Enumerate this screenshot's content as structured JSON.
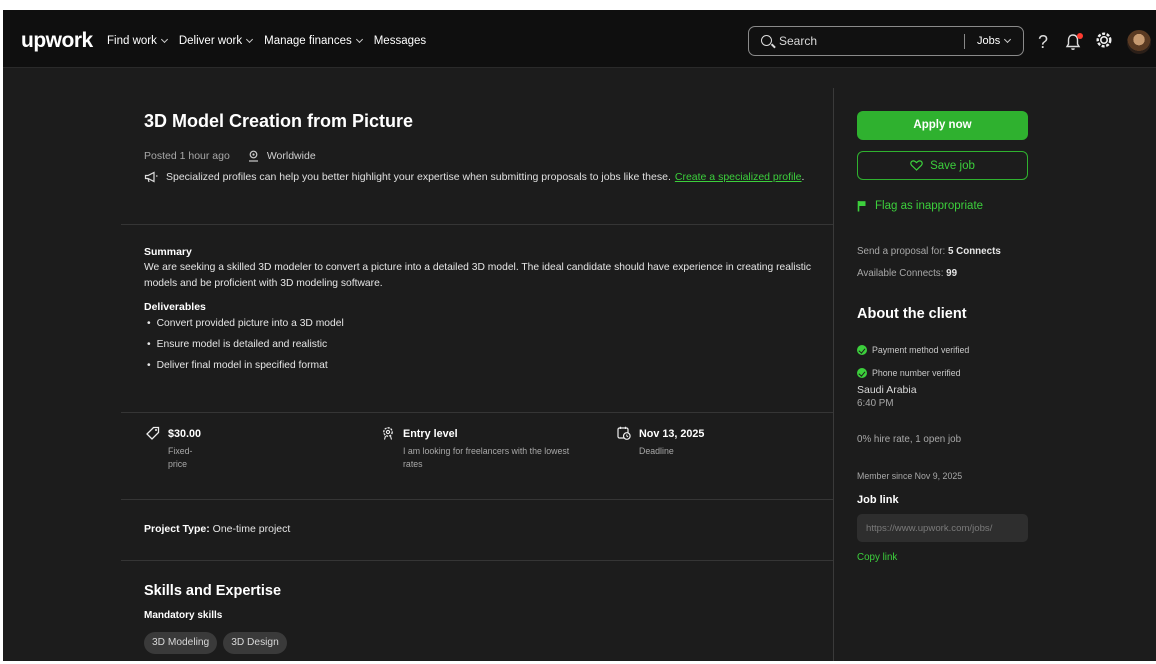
{
  "nav": {
    "logo": "upwork",
    "links": [
      "Find work",
      "Deliver work",
      "Manage finances",
      "Messages"
    ],
    "search_placeholder": "Search",
    "search_scope": "Jobs",
    "help": "?"
  },
  "job": {
    "title": "3D Model Creation from Picture",
    "posted": "Posted 1 hour ago",
    "location": "Worldwide",
    "tip_text": "Specialized profiles can help you better highlight your expertise when submitting proposals to jobs like these.",
    "tip_link": "Create a specialized profile",
    "summary_heading": "Summary",
    "summary_text": "We are seeking a skilled 3D modeler to convert a picture into a detailed 3D model. The ideal candidate should have experience in creating realistic models and be proficient with 3D modeling software.",
    "deliverables_heading": "Deliverables",
    "deliverables": [
      "Convert provided picture into a 3D model",
      "Ensure model is detailed and realistic",
      "Deliver final model in specified format"
    ],
    "facts": {
      "price": "$30.00",
      "price_sub": "Fixed-price",
      "level": "Entry level",
      "level_sub": "I am looking for freelancers with the lowest rates",
      "deadline": "Nov 13, 2025",
      "deadline_sub": "Deadline"
    },
    "project_type_label": "Project Type:",
    "project_type_value": "One-time project",
    "skills_heading": "Skills and Expertise",
    "mandatory_label": "Mandatory skills",
    "skills": [
      "3D Modeling",
      "3D Design"
    ]
  },
  "sidebar": {
    "apply_label": "Apply now",
    "save_label": "Save job",
    "flag_label": "Flag as inappropriate",
    "proposal_label": "Send a proposal for:",
    "proposal_value": "5 Connects",
    "available_label": "Available Connects:",
    "available_value": "99",
    "about_heading": "About the client",
    "payment_verified": "Payment method verified",
    "phone_verified": "Phone number verified",
    "country": "Saudi Arabia",
    "client_time": "6:40 PM",
    "hire_rate": "0% hire rate, 1 open job",
    "member_since": "Member since Nov 9, 2025",
    "job_link_heading": "Job link",
    "job_link_value": "https://www.upwork.com/jobs/",
    "copy_link": "Copy link"
  },
  "colors": {
    "accent_green": "#2fb12f",
    "link_green": "#3ccf3c",
    "background": "#1c1c1c",
    "notification_dot": "#ff3b30"
  },
  "icons": [
    "search-icon",
    "chevron-down-icon",
    "help-icon",
    "bell-icon",
    "gear-icon",
    "avatar",
    "location-pin-icon",
    "megaphone-icon",
    "price-tag-icon",
    "experience-level-icon",
    "calendar-clock-icon",
    "heart-icon",
    "flag-icon",
    "check-circle-icon"
  ]
}
